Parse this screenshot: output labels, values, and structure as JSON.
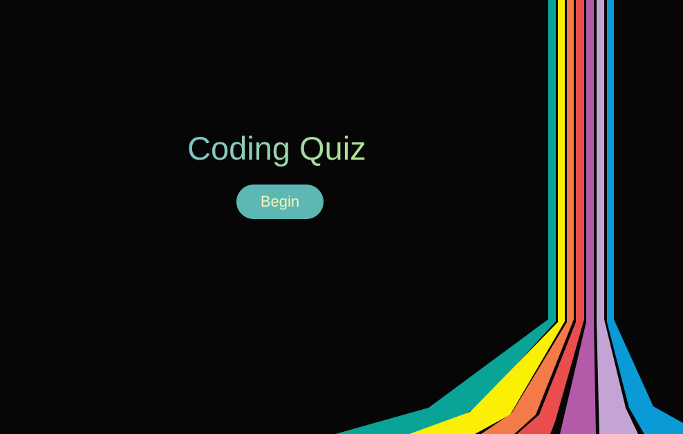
{
  "page": {
    "title": "Coding Quiz",
    "begin_label": "Begin"
  },
  "colors": {
    "background": "#060606",
    "title_gradient_start": "#7cc4c9",
    "title_gradient_end": "#b9e48e",
    "button_background": "#5db8b4",
    "button_text": "#f4f7b4"
  },
  "decoration": {
    "stripe_colors": [
      "#0aa398",
      "#fbf004",
      "#f47a48",
      "#e94e4d",
      "#b35aa8",
      "#c4a4d4",
      "#0a9ad6"
    ]
  }
}
